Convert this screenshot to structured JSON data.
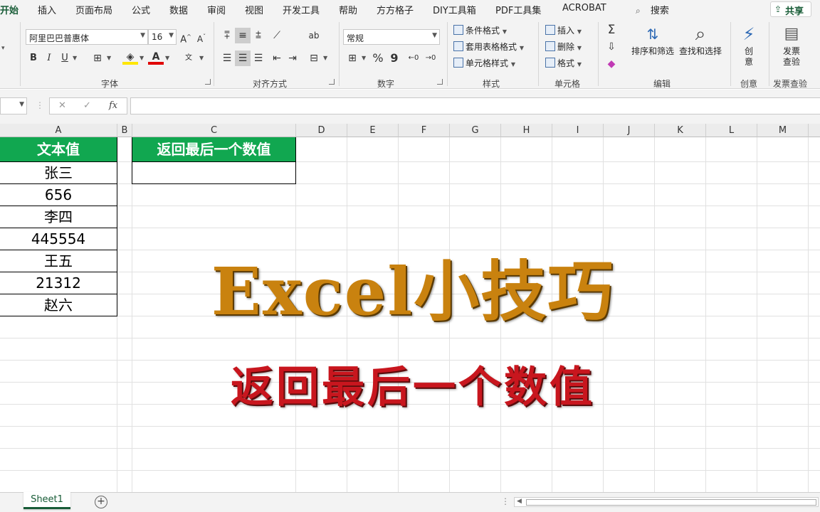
{
  "ribbon_tabs": [
    "开始",
    "插入",
    "页面布局",
    "公式",
    "数据",
    "审阅",
    "视图",
    "开发工具",
    "帮助",
    "方方格子",
    "DIY工具箱",
    "PDF工具集",
    "ACROBAT",
    "搜索"
  ],
  "share_label": "共享",
  "font": {
    "name": "阿里巴巴普惠体",
    "size": "16",
    "bold": "B",
    "italic": "I",
    "underline": "U",
    "group_label": "字体"
  },
  "alignment": {
    "group_label": "对齐方式"
  },
  "number": {
    "format": "常规",
    "percent": "%",
    "comma": "9",
    "group_label": "数字"
  },
  "styles": {
    "conditional": "条件格式",
    "table": "套用表格格式",
    "cell": "单元格样式",
    "group_label": "样式"
  },
  "cells": {
    "insert": "插入",
    "delete": "删除",
    "format": "格式",
    "group_label": "单元格"
  },
  "editing": {
    "sort_filter": "排序和筛选",
    "find_select": "查找和选择",
    "group_label": "编辑"
  },
  "creative": {
    "label": "创意",
    "button": "创\n意"
  },
  "invoice": {
    "label": "发票查验",
    "button": "发票查验"
  },
  "formula_bar": {
    "fx": "fx",
    "cancel": "✕",
    "enter": "✓"
  },
  "columns": [
    "A",
    "B",
    "C",
    "D",
    "E",
    "F",
    "G",
    "H",
    "I",
    "J",
    "K",
    "L",
    "M"
  ],
  "table_a": {
    "header": "文本值",
    "rows": [
      "张三",
      "656",
      "李四",
      "445554",
      "王五",
      "21312",
      "赵六"
    ]
  },
  "table_c": {
    "header": "返回最后一个数值",
    "value": ""
  },
  "overlay": {
    "title": "Excel小技巧",
    "subtitle": "返回最后一个数值"
  },
  "sheet_tab": "Sheet1",
  "colors": {
    "excel_green": "#185c37",
    "header_green": "#11a750",
    "title_gold": "#c9820f",
    "subtitle_red": "#c8161e"
  }
}
